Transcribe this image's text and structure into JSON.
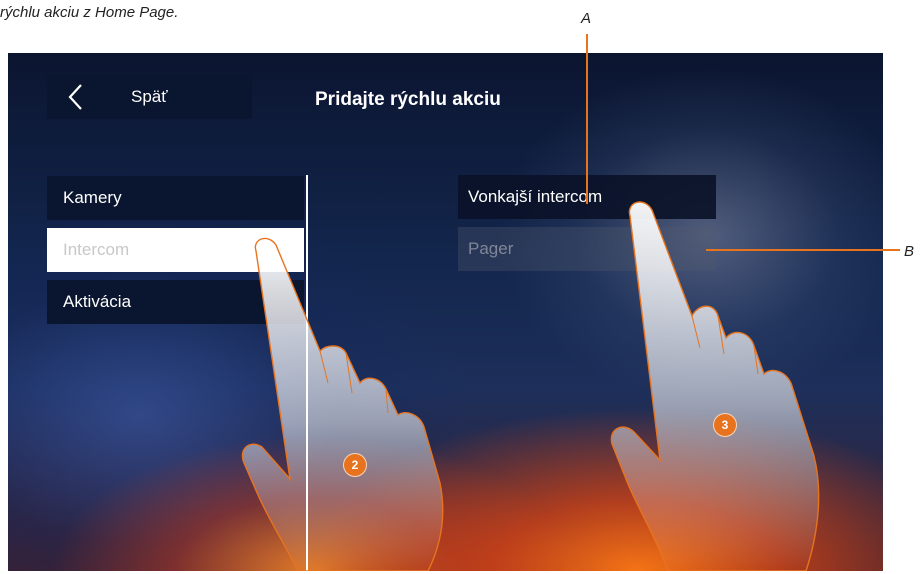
{
  "caption": "rýchlu akciu z Home Page.",
  "callouts": {
    "a": "A",
    "b": "B"
  },
  "header": {
    "back_label": "Späť",
    "title": "Pridajte rýchlu akciu"
  },
  "categories": [
    {
      "label": "Kamery",
      "state": "normal"
    },
    {
      "label": "Intercom",
      "state": "selected"
    },
    {
      "label": "Aktivácia",
      "state": "normal"
    }
  ],
  "options": [
    {
      "label": "Vonkajší intercom",
      "state": "enabled"
    },
    {
      "label": "Pager",
      "state": "disabled"
    }
  ],
  "steps": {
    "left": "2",
    "right": "3"
  },
  "colors": {
    "accent": "#e8731e",
    "panel_dark": "#0a1530"
  },
  "icons": {
    "back": "chevron-left-icon",
    "hand": "pointing-hand-icon"
  }
}
